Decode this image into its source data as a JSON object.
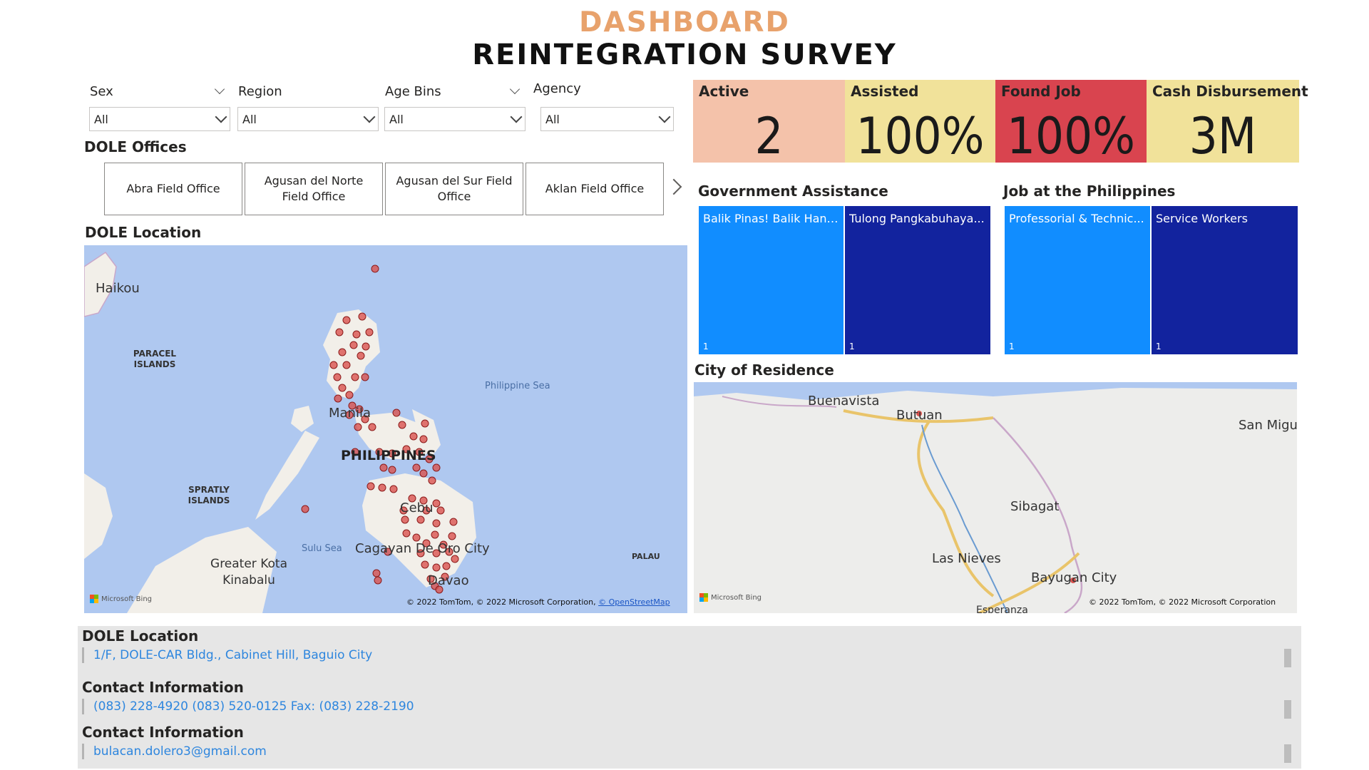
{
  "header": {
    "title_top": "DASHBOARD",
    "title_main": "REINTEGRATION SURVEY"
  },
  "slicers": [
    {
      "label": "Sex",
      "value": "All"
    },
    {
      "label": "Region",
      "value": "All"
    },
    {
      "label": "Age Bins",
      "value": "All"
    },
    {
      "label": "Agency",
      "value": "All"
    }
  ],
  "dole_offices": {
    "title": "DOLE Offices",
    "items": [
      "Abra Field Office",
      "Agusan del Norte Field Office",
      "Agusan del Sur Field Office",
      "Aklan Field Office"
    ]
  },
  "dole_location_map": {
    "title": "DOLE Location",
    "labels": {
      "haikou": "Haikou",
      "paracel": "PARACEL ISLANDS",
      "spratly": "SPRATLY ISLANDS",
      "philippine_sea": "Philippine Sea",
      "manila": "Manila",
      "philippines": "PHILIPPINES",
      "cebu": "Cebu",
      "sulu_sea": "Sulu Sea",
      "kota_kinabalu": "Greater Kota Kinabalu",
      "cagayan": "Cagayan De Oro City",
      "davao": "Davao",
      "palau": "PALAU"
    },
    "bing": "Microsoft Bing",
    "copyright": "© 2022 TomTom, © 2022 Microsoft Corporation,",
    "copyright_link": "© OpenStreetMap"
  },
  "kpis": [
    {
      "label": "Active",
      "value": "2",
      "color": "#F4C2AA"
    },
    {
      "label": "Assisted",
      "value": "100%",
      "color": "#F1E29A"
    },
    {
      "label": "Found Job",
      "value": "100%",
      "color": "#D9444F"
    },
    {
      "label": "Cash Disbursement",
      "value": "3M",
      "color": "#F1E29A"
    }
  ],
  "government_assistance": {
    "title": "Government Assistance",
    "cells": [
      {
        "label": "Balik Pinas! Balik Hana...",
        "count": "1",
        "color": "#118DFF"
      },
      {
        "label": "Tulong Pangkabuhaya...",
        "count": "1",
        "color": "#12239E"
      }
    ]
  },
  "job_philippines": {
    "title": "Job at the Philippines",
    "cells": [
      {
        "label": "Professorial & Technic...",
        "count": "1",
        "color": "#118DFF"
      },
      {
        "label": "Service Workers",
        "count": "1",
        "color": "#12239E"
      }
    ]
  },
  "city_map": {
    "title": "City of Residence",
    "labels": {
      "buenavista": "Buenavista",
      "butuan": "Butuan",
      "san_mig": "San Migu",
      "sibagat": "Sibagat",
      "las_nieves": "Las Nieves",
      "bayugan": "Bayugan City",
      "esperanza": "Esperanza"
    },
    "bing": "Microsoft Bing",
    "copyright": "© 2022 TomTom, © 2022 Microsoft Corporation"
  },
  "info_panel": {
    "location_title": "DOLE Location",
    "location_value": "1/F, DOLE-CAR Bldg., Cabinet Hill, Baguio City",
    "contact_title_1": "Contact Information",
    "contact_value_1": "(083) 228-4920 (083) 520-0125 Fax: (083) 228-2190",
    "contact_title_2": "Contact Information",
    "contact_value_2": "bulacan.dolero3@gmail.com"
  }
}
